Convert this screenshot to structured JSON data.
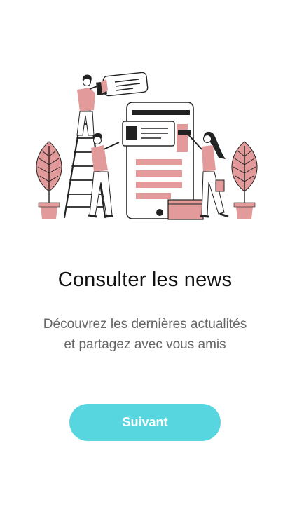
{
  "onboarding": {
    "illustration_icon": "news-team-illustration",
    "title": "Consulter les news",
    "description_line1": "Découvrez les dernières actualités",
    "description_line2": "et partagez avec vous amis",
    "next_label": "Suivant"
  },
  "colors": {
    "accent": "#58d6e0",
    "illustration_pink": "#e39a9a",
    "title": "#111111",
    "description": "#666666",
    "background": "#ffffff"
  }
}
